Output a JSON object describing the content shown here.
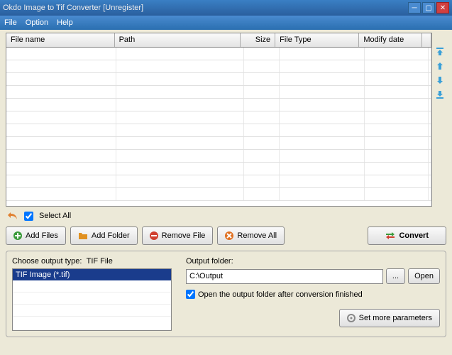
{
  "window": {
    "title": "Okdo Image to Tif Converter [Unregister]"
  },
  "menu": {
    "file": "File",
    "option": "Option",
    "help": "Help"
  },
  "grid": {
    "headers": {
      "name": "File name",
      "path": "Path",
      "size": "Size",
      "type": "File Type",
      "date": "Modify date"
    }
  },
  "select_all": "Select All",
  "buttons": {
    "add_files": "Add Files",
    "add_folder": "Add Folder",
    "remove_file": "Remove File",
    "remove_all": "Remove All",
    "convert": "Convert",
    "browse": "...",
    "open": "Open",
    "set_params": "Set more parameters"
  },
  "output_type": {
    "label_prefix": "Choose output type:",
    "label_value": "TIF File",
    "selected": "TIF Image (*.tif)"
  },
  "output_folder": {
    "label": "Output folder:",
    "value": "C:\\Output",
    "open_after": "Open the output folder after conversion finished"
  }
}
